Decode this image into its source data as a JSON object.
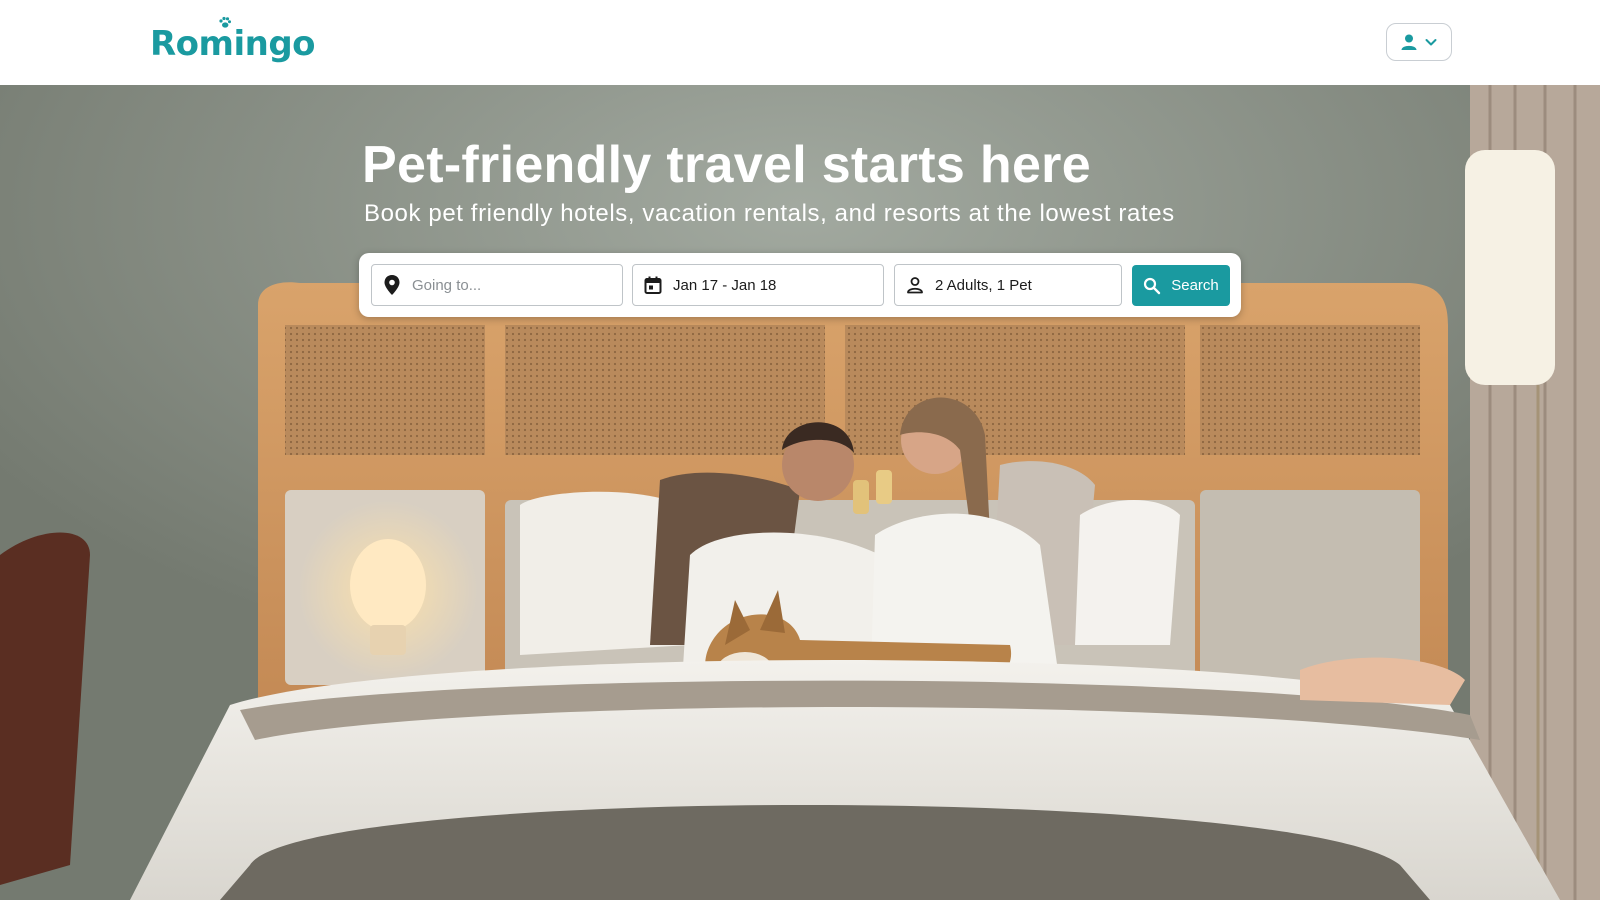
{
  "brand": {
    "name": "Romingo",
    "accent": "#1a9aa0"
  },
  "header": {
    "account_menu": {
      "icons": [
        "person-icon",
        "chevron-down-icon"
      ]
    }
  },
  "hero": {
    "title": "Pet-friendly travel starts here",
    "subtitle": "Book pet friendly hotels, vacation rentals, and resorts at the lowest rates"
  },
  "search": {
    "destination": {
      "placeholder": "Going to...",
      "value": ""
    },
    "dates": {
      "value": "Jan 17 - Jan 18"
    },
    "guests": {
      "value": "2 Adults, 1 Pet"
    },
    "button_label": "Search"
  }
}
